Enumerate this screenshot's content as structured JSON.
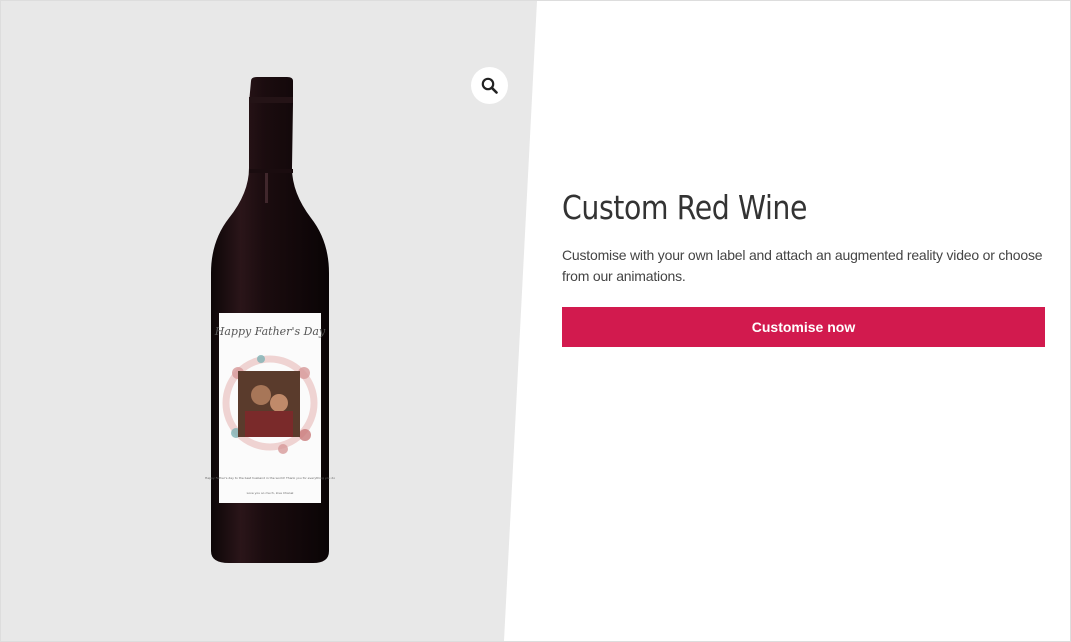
{
  "gallery": {
    "zoom_icon": "magnifier-icon",
    "image": {
      "label_title": "Happy Father's Day",
      "label_message": "Happy Father's day to the best husband in the world! Thank you for everything you do",
      "label_signoff": "Love you so much, love Chanel"
    }
  },
  "product": {
    "title": "Custom Red Wine",
    "description": "Customise with your own label and attach an augmented reality video or choose from our animations.",
    "cta_label": "Customise now"
  },
  "colors": {
    "gallery_background": "#e8e8e8",
    "accent": "#d21a4e",
    "bottle": "#1c0e10"
  }
}
